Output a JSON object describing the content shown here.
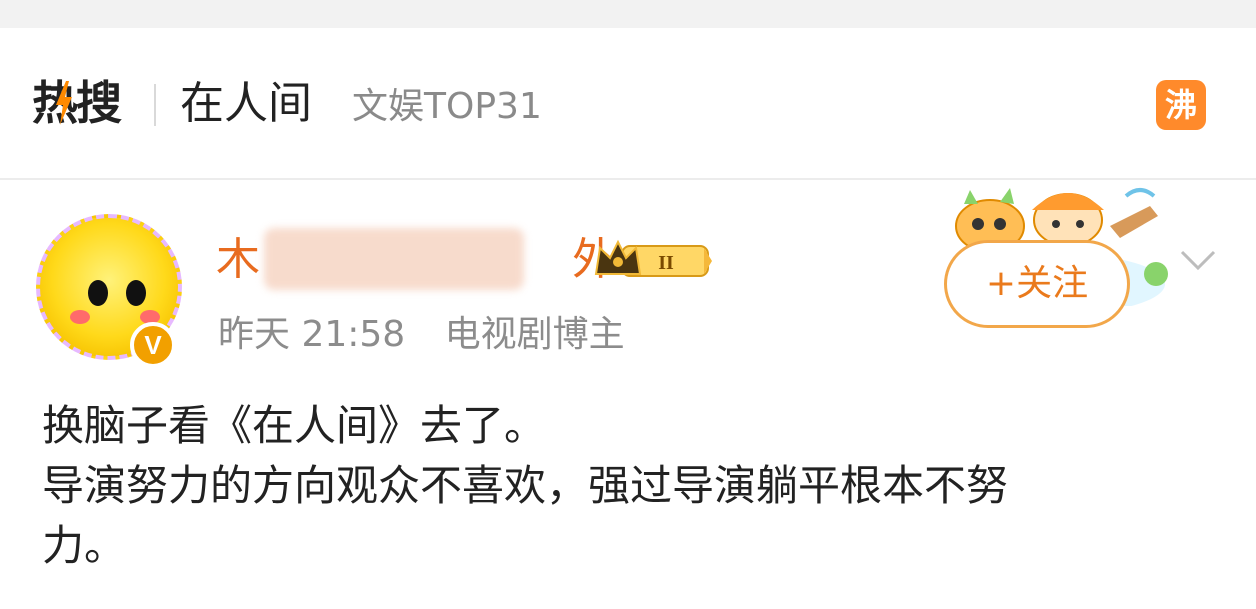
{
  "header": {
    "logo_text": "热搜",
    "topic": "在人间",
    "rank_label": "文娱TOP31",
    "status_badge": "沸"
  },
  "post": {
    "author_name_start": "木",
    "author_name_end": "外",
    "level_badge": "II",
    "time": "昨天 21:58",
    "author_tag": "电视剧博主",
    "follow_label": "+关注",
    "lines": [
      "换脑子看《在人间》去了。",
      "导演努力的方向观众不喜欢，强过导演躺平根本不努",
      "力。"
    ]
  },
  "colors": {
    "accent_orange": "#ea7a1c",
    "name_orange": "#e86b1f",
    "badge_orange": "#ff8a2b",
    "meta_gray": "#8c8c8c"
  },
  "icons": [
    "hot-bolt-icon",
    "crown-icon",
    "verified-v-icon",
    "chevron-down-icon"
  ]
}
